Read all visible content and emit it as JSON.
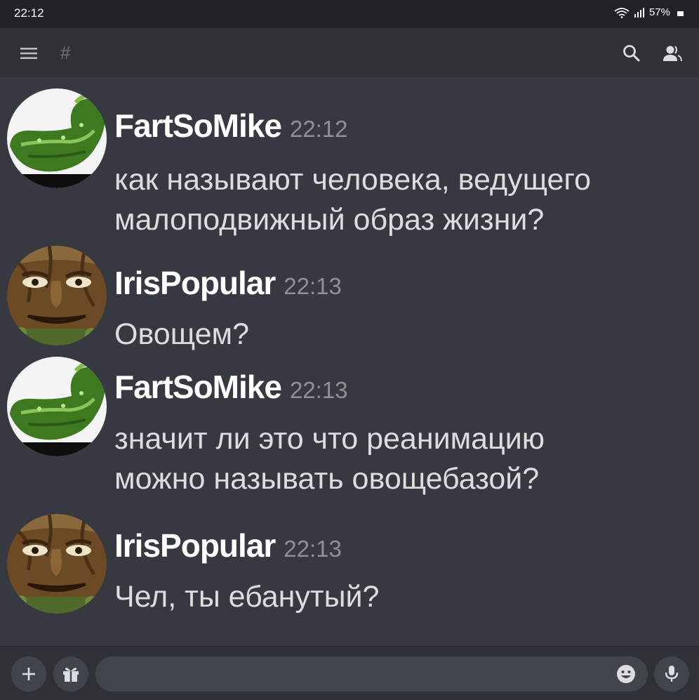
{
  "status_bar": {
    "time": "22:12",
    "battery": "57%"
  },
  "header": {
    "channel_symbol": "#"
  },
  "messages": [
    {
      "author": "FartSoMike",
      "time": "22:12",
      "lines": [
        "как называют человека, ведущего",
        "малоподвижный образ жизни?"
      ],
      "avatar": "cucumber-avatar"
    },
    {
      "author": "IrisPopular",
      "time": "22:13",
      "lines": [
        "Овощем?"
      ],
      "avatar": "tree-face-avatar"
    },
    {
      "author": "FartSoMike",
      "time": "22:13",
      "lines": [
        "значит ли это что реанимацию",
        "можно называть овощебазой?"
      ],
      "avatar": "cucumber-avatar"
    },
    {
      "author": "IrisPopular",
      "time": "22:13",
      "lines": [
        "Чел, ты ебанутый?"
      ],
      "avatar": "tree-face-avatar"
    }
  ],
  "icons": {
    "menu": "hamburger-menu-icon",
    "search": "search-icon",
    "members": "members-icon",
    "add": "plus-icon",
    "gift": "gift-icon",
    "emoji": "emoji-icon",
    "mic": "microphone-icon"
  },
  "colors": {
    "background": "#36393f",
    "header": "#2f3136",
    "statusbar": "#202225",
    "input": "#40444b",
    "timestamp": "#8e9297"
  }
}
